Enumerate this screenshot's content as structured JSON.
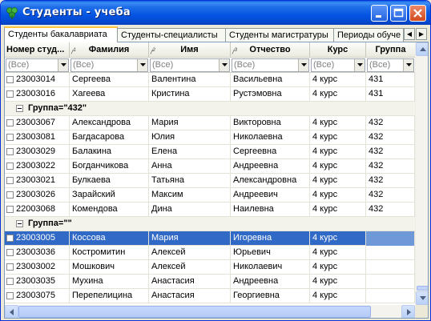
{
  "window": {
    "title": "Студенты - учеба"
  },
  "tabs": [
    {
      "label": "Студенты бакалавриата",
      "active": true
    },
    {
      "label": "Студенты-специалисты",
      "active": false
    },
    {
      "label": "Студенты магистратуры",
      "active": false
    },
    {
      "label": "Периоды обуче",
      "active": false
    }
  ],
  "columns": [
    {
      "key": "number",
      "label": "Номер студ...",
      "sort": ""
    },
    {
      "key": "surname",
      "label": "Фамилия",
      "sort": "1"
    },
    {
      "key": "name",
      "label": "Имя",
      "sort": "2"
    },
    {
      "key": "patronymic",
      "label": "Отчество",
      "sort": "3"
    },
    {
      "key": "course",
      "label": "Курс",
      "sort": ""
    },
    {
      "key": "group",
      "label": "Группа",
      "sort": ""
    }
  ],
  "filter_placeholder": "(Все)",
  "rows": [
    {
      "type": "data",
      "number": "23003014",
      "surname": "Сергеева",
      "name": "Валентина",
      "patronymic": "Васильевна",
      "course": "4 курс",
      "group": "431"
    },
    {
      "type": "data",
      "number": "23003016",
      "surname": "Хагеева",
      "name": "Кристина",
      "patronymic": "Рустэмовна",
      "course": "4 курс",
      "group": "431"
    },
    {
      "type": "group",
      "label": "Группа=\"432\""
    },
    {
      "type": "data",
      "number": "23003067",
      "surname": "Александрова",
      "name": "Мария",
      "patronymic": "Викторовна",
      "course": "4 курс",
      "group": "432"
    },
    {
      "type": "data",
      "number": "23003081",
      "surname": "Багдасарова",
      "name": "Юлия",
      "patronymic": "Николаевна",
      "course": "4 курс",
      "group": "432"
    },
    {
      "type": "data",
      "number": "23003029",
      "surname": "Балакина",
      "name": "Елена",
      "patronymic": "Сергеевна",
      "course": "4 курс",
      "group": "432"
    },
    {
      "type": "data",
      "number": "23003022",
      "surname": "Богданчикова",
      "name": "Анна",
      "patronymic": "Андреевна",
      "course": "4 курс",
      "group": "432"
    },
    {
      "type": "data",
      "number": "23003021",
      "surname": "Булкаева",
      "name": "Татьяна",
      "patronymic": "Александровна",
      "course": "4 курс",
      "group": "432"
    },
    {
      "type": "data",
      "number": "23003026",
      "surname": "Зарайский",
      "name": "Максим",
      "patronymic": "Андреевич",
      "course": "4 курс",
      "group": "432"
    },
    {
      "type": "data",
      "number": "22003068",
      "surname": "Комендова",
      "name": "Дина",
      "patronymic": "Наилевна",
      "course": "4 курс",
      "group": "432"
    },
    {
      "type": "group",
      "label": "Группа=\"\""
    },
    {
      "type": "data",
      "selected": true,
      "number": "23003005",
      "surname": "Коссова",
      "name": "Мария",
      "patronymic": "Игоревна",
      "course": "4 курс",
      "group": ""
    },
    {
      "type": "data",
      "number": "23003036",
      "surname": "Костромитин",
      "name": "Алексей",
      "patronymic": "Юрьевич",
      "course": "4 курс",
      "group": ""
    },
    {
      "type": "data",
      "number": "23003002",
      "surname": "Мошкович",
      "name": "Алексей",
      "patronymic": "Николаевич",
      "course": "4 курс",
      "group": ""
    },
    {
      "type": "data",
      "number": "23003035",
      "surname": "Мухина",
      "name": "Анастасия",
      "patronymic": "Андреевна",
      "course": "4 курс",
      "group": ""
    },
    {
      "type": "data",
      "number": "23003075",
      "surname": "Перепелицина",
      "name": "Анастасия",
      "patronymic": "Георгиевна",
      "course": "4 курс",
      "group": ""
    }
  ]
}
